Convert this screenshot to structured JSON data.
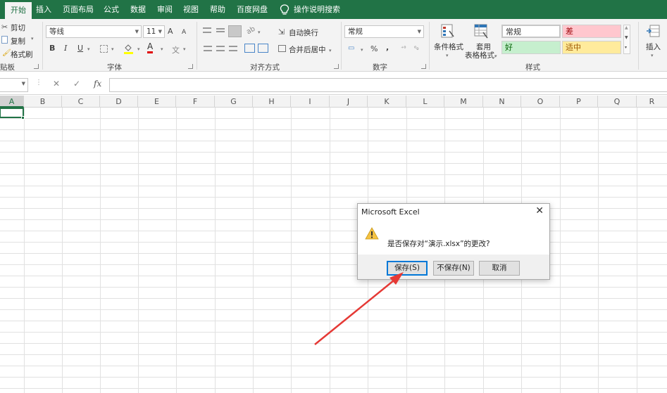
{
  "tabs": [
    "开始",
    "插入",
    "页面布局",
    "公式",
    "数据",
    "审阅",
    "视图",
    "帮助",
    "百度网盘"
  ],
  "tell_me": "操作说明搜索",
  "ribbon": {
    "clipboard": {
      "cut": "剪切",
      "copy": "复制",
      "format_painter": "格式刷",
      "group": "贴板"
    },
    "font": {
      "name": "等线",
      "size": "11",
      "group": "字体",
      "bold": "B",
      "italic": "I",
      "underline": "U",
      "grow": "A",
      "shrink": "A",
      "font_color": "A"
    },
    "alignment": {
      "wrap": "自动换行",
      "merge": "合并后居中",
      "group": "对齐方式"
    },
    "number": {
      "format": "常规",
      "percent": "%",
      "comma": ",",
      "group": "数字"
    },
    "styles": {
      "conditional": "条件格式",
      "table_line1": "套用",
      "table_line2": "表格格式",
      "normal": "常规",
      "bad": "差",
      "good": "好",
      "neutral": "适中",
      "group": "样式"
    },
    "cells": {
      "insert": "插入"
    }
  },
  "formula_bar": {
    "fx": "fx",
    "cancel": "✕",
    "enter": "✓"
  },
  "columns": [
    "A",
    "B",
    "C",
    "D",
    "E",
    "F",
    "G",
    "H",
    "I",
    "J",
    "K",
    "L",
    "M",
    "N",
    "O",
    "P",
    "Q",
    "R"
  ],
  "dialog": {
    "title": "Microsoft Excel",
    "message": "是否保存对“演示.xlsx”的更改?",
    "save": "保存(S)",
    "dont_save": "不保存(N)",
    "cancel": "取消"
  },
  "colors": {
    "accent": "#217346",
    "bad_bg": "#ffc7ce",
    "bad_fg": "#9c0006",
    "good_bg": "#c6efce",
    "good_fg": "#006100",
    "neutral_bg": "#ffeb9c",
    "neutral_fg": "#9c5700",
    "arrow": "#e53935"
  }
}
